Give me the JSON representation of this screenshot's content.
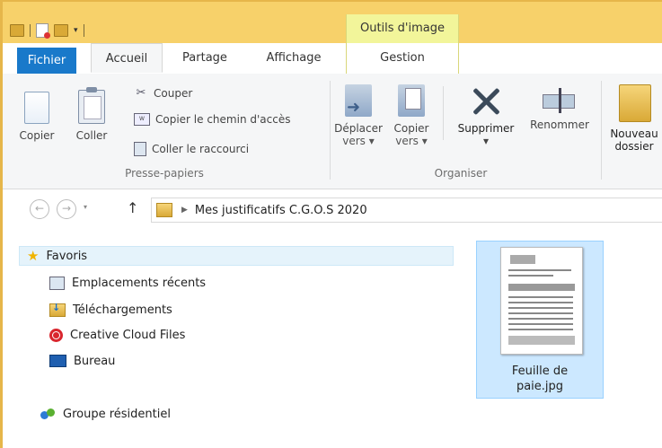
{
  "titlebar": {
    "context_tab_group": "Outils d'image"
  },
  "tabs": {
    "fichier": "Fichier",
    "accueil": "Accueil",
    "partage": "Partage",
    "affichage": "Affichage",
    "gestion": "Gestion"
  },
  "ribbon": {
    "presse_papiers": {
      "label": "Presse-papiers",
      "copier": "Copier",
      "coller": "Coller",
      "couper": "Couper",
      "copier_chemin": "Copier le chemin d'accès",
      "coller_raccourci": "Coller le raccourci"
    },
    "organiser": {
      "label": "Organiser",
      "deplacer_line1": "Déplacer",
      "deplacer_line2": "vers ▾",
      "copier_line1": "Copier",
      "copier_line2": "vers ▾",
      "supprimer": "Supprimer",
      "supprimer_arrow": "▾",
      "renommer": "Renommer"
    },
    "nouveau": {
      "line1": "Nouveau",
      "line2": "dossier"
    }
  },
  "address": {
    "back": "←",
    "forward": "→",
    "recent": "▾",
    "up": "↑",
    "chevron": "▶",
    "path": "Mes justificatifs C.G.O.S 2020"
  },
  "navpane": {
    "favoris": "Favoris",
    "items": [
      "Emplacements récents",
      "Téléchargements",
      "Creative Cloud Files",
      "Bureau"
    ],
    "groupe": "Groupe résidentiel"
  },
  "files": [
    {
      "name_line1": "Feuille de",
      "name_line2": "paie.jpg"
    }
  ],
  "colors": {
    "titlebar": "#f7d16a",
    "context_tab": "#f2f59a",
    "fichier_tab": "#1979ca",
    "selection": "#cce8ff"
  }
}
